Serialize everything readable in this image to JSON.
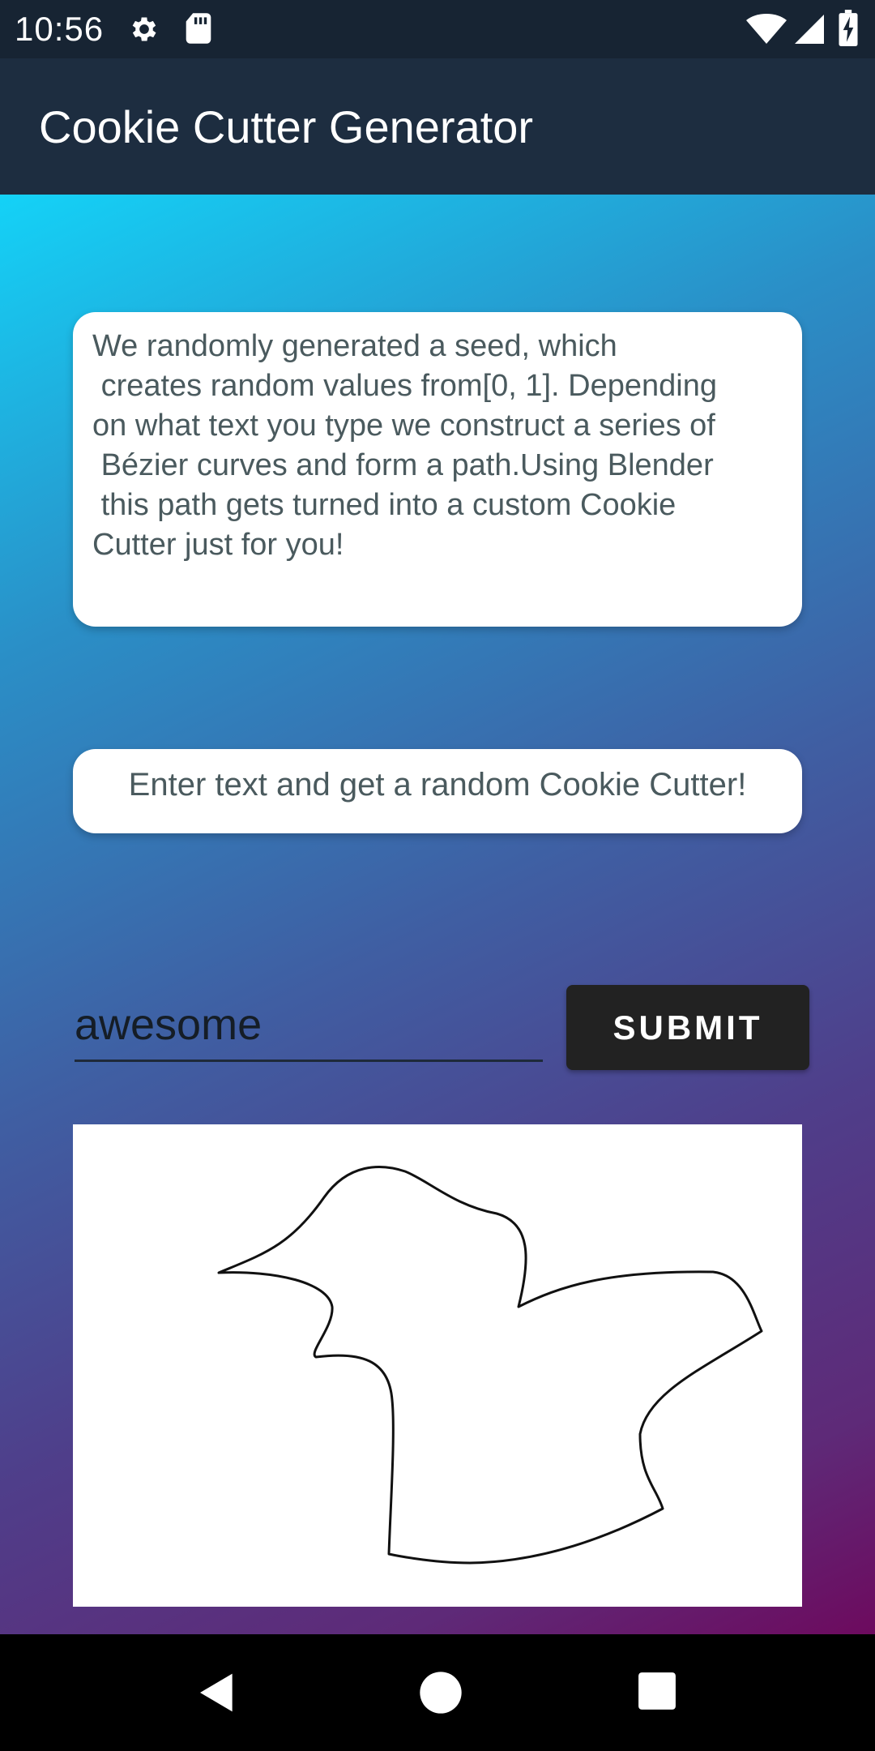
{
  "status_bar": {
    "time": "10:56",
    "icons": [
      "gear-icon",
      "sd-card-icon",
      "wifi-icon",
      "cell-signal-icon",
      "battery-charging-icon"
    ]
  },
  "app_bar": {
    "title": "Cookie Cutter Generator"
  },
  "info_card": {
    "text": "We randomly generated a seed, which\n creates random values from[0, 1]. Depending\non what text you type we construct a series of\n Bézier curves and form a path.Using Blender\n this path gets turned into a custom Cookie\nCutter just for you!"
  },
  "prompt_card": {
    "text": "Enter text and get a random Cookie Cutter!"
  },
  "form": {
    "input_value": "awesome",
    "submit_label": "SUBMIT"
  },
  "nav_bar": {
    "icons": [
      "back-icon",
      "home-icon",
      "recents-icon"
    ]
  },
  "colors": {
    "status_bar": "#172433",
    "app_bar": "#1d2d40",
    "gradient_start": "#14d2f7",
    "gradient_end": "#6d0a5e",
    "submit_button": "#222222"
  }
}
